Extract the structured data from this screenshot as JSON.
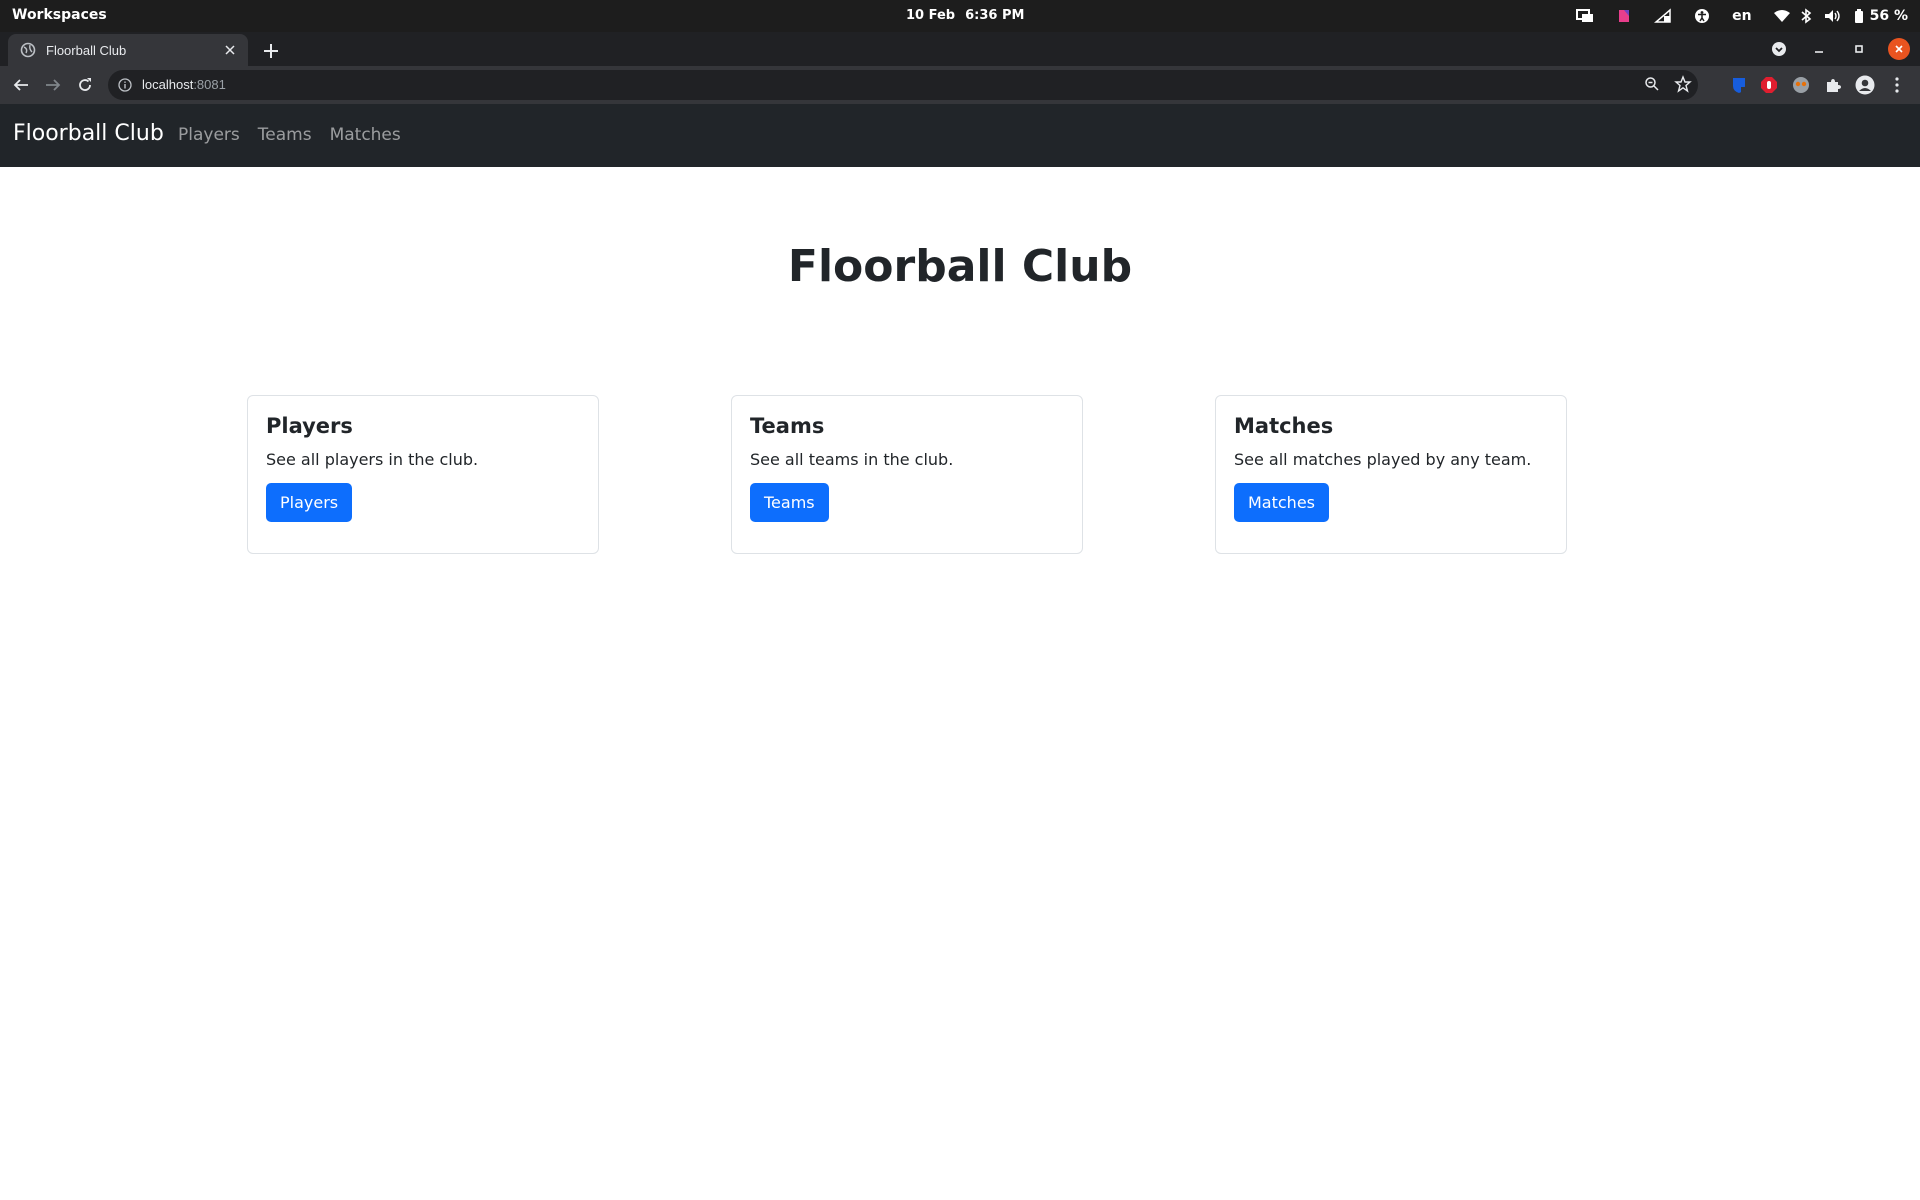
{
  "os": {
    "workspaces_label": "Workspaces",
    "date": "10 Feb",
    "time": "6:36 PM",
    "keyboard_layout": "en",
    "battery_percent": "56 %"
  },
  "browser": {
    "tab_title": "Floorball Club",
    "url_host": "localhost",
    "url_port": ":8081"
  },
  "navbar": {
    "brand": "Floorball Club",
    "links": [
      "Players",
      "Teams",
      "Matches"
    ]
  },
  "main": {
    "title": "Floorball Club",
    "cards": [
      {
        "title": "Players",
        "text": "See all players in the club.",
        "button": "Players"
      },
      {
        "title": "Teams",
        "text": "See all teams in the club.",
        "button": "Teams"
      },
      {
        "title": "Matches",
        "text": "See all matches played by any team.",
        "button": "Matches"
      }
    ]
  },
  "colors": {
    "navbar_bg": "#212529",
    "primary_button": "#0d6efd",
    "os_close": "#e95420"
  }
}
